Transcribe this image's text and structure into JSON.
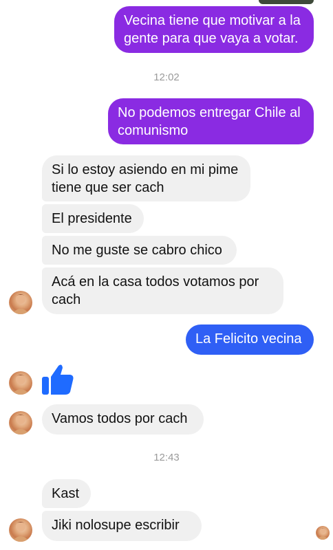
{
  "messages": {
    "m1": "Vecina tiene que motivar a la\ngente para que vaya a votar.",
    "t1": "12:02",
    "m2": "No podemos entregar Chile al\ncomunismo",
    "m3": "Si lo estoy asiendo en mi pime\ntiene que ser cach",
    "m4": "El presidente",
    "m5": "No me guste se cabro chico",
    "m6": "Acá en la casa todos votamos por\ncach",
    "m7": "La Felicito vecina",
    "m8": "Vamos todos por cach",
    "t2": "12:43",
    "m9": "Kast",
    "m10": "Jiki  nolosupe  escribir"
  },
  "colors": {
    "outgoing_purple": "#8a2be2",
    "outgoing_blue": "#2f5ff5",
    "incoming_bg": "#f0f0f0",
    "like_icon": "#1f6bff"
  },
  "icons": {
    "like": "thumbs-up-icon",
    "avatar": "contact-avatar",
    "seen": "seen-avatar"
  }
}
